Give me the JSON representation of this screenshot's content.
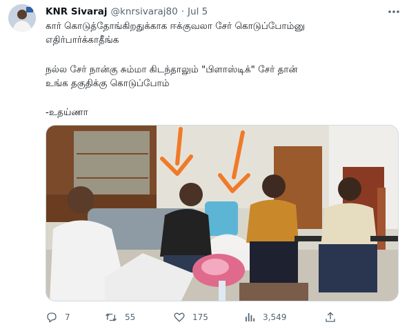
{
  "tweet": {
    "author": {
      "display_name": "KNR Sivaraj",
      "handle": "@knrsivaraj80",
      "separator": "·",
      "date": "Jul 5"
    },
    "lines": [
      "கார் கொடுத்தோங்கிறதுக்காக ஈக்குவலா சேர் கொடுப்போம்னு",
      "எதிர்பார்க்காதீங்க",
      "நல்ல சேர் நான்கு சும்மா கிடந்தாலும் \"பிளாஸ்டிக்\" சேர் தான்",
      "உங்க தகுதிக்கு கொடுப்போம்",
      "-உதய்ணா"
    ],
    "media": {
      "type": "photo",
      "colors": {
        "arrow": "#f07a2a",
        "wall": "#d9d7cc",
        "floor": "#c9c3b8"
      }
    },
    "actions": {
      "reply": {
        "icon": "reply-icon",
        "count": "7"
      },
      "retweet": {
        "icon": "retweet-icon",
        "count": "55"
      },
      "like": {
        "icon": "heart-icon",
        "count": "175"
      },
      "views": {
        "icon": "views-icon",
        "count": "3,549"
      },
      "share": {
        "icon": "share-icon"
      }
    }
  },
  "colors": {
    "text": "#0f1419",
    "secondary": "#536471",
    "border": "#cfd9de"
  }
}
